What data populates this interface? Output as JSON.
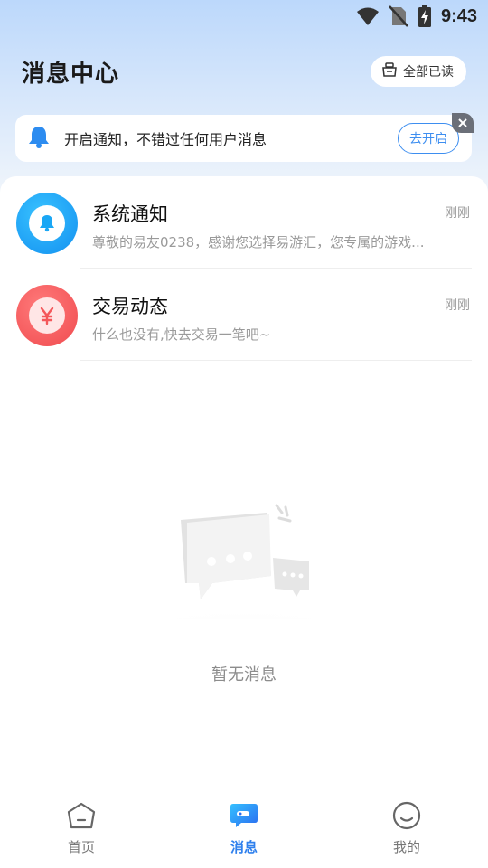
{
  "status_bar": {
    "time": "9:43"
  },
  "header": {
    "title": "消息中心",
    "read_all_label": "全部已读"
  },
  "notify_banner": {
    "text": "开启通知，不错过任何用户消息",
    "button_label": "去开启"
  },
  "messages": [
    {
      "title": "系统通知",
      "time": "刚刚",
      "preview": "尊敬的易友0238，感谢您选择易游汇，您专属的游戏...",
      "icon": "bell-icon",
      "color": "#1aa7f5"
    },
    {
      "title": "交易动态",
      "time": "刚刚",
      "preview": "什么也没有,快去交易一笔吧~",
      "icon": "yuan-icon",
      "color": "#f4585b"
    }
  ],
  "empty_state": {
    "text": "暂无消息"
  },
  "tab_bar": {
    "tabs": [
      {
        "label": "首页",
        "icon": "home-icon",
        "active": false
      },
      {
        "label": "消息",
        "icon": "message-icon",
        "active": true
      },
      {
        "label": "我的",
        "icon": "profile-icon",
        "active": false
      }
    ]
  },
  "colors": {
    "accent": "#2f80ed",
    "banner_button": "#3d8ef0"
  }
}
